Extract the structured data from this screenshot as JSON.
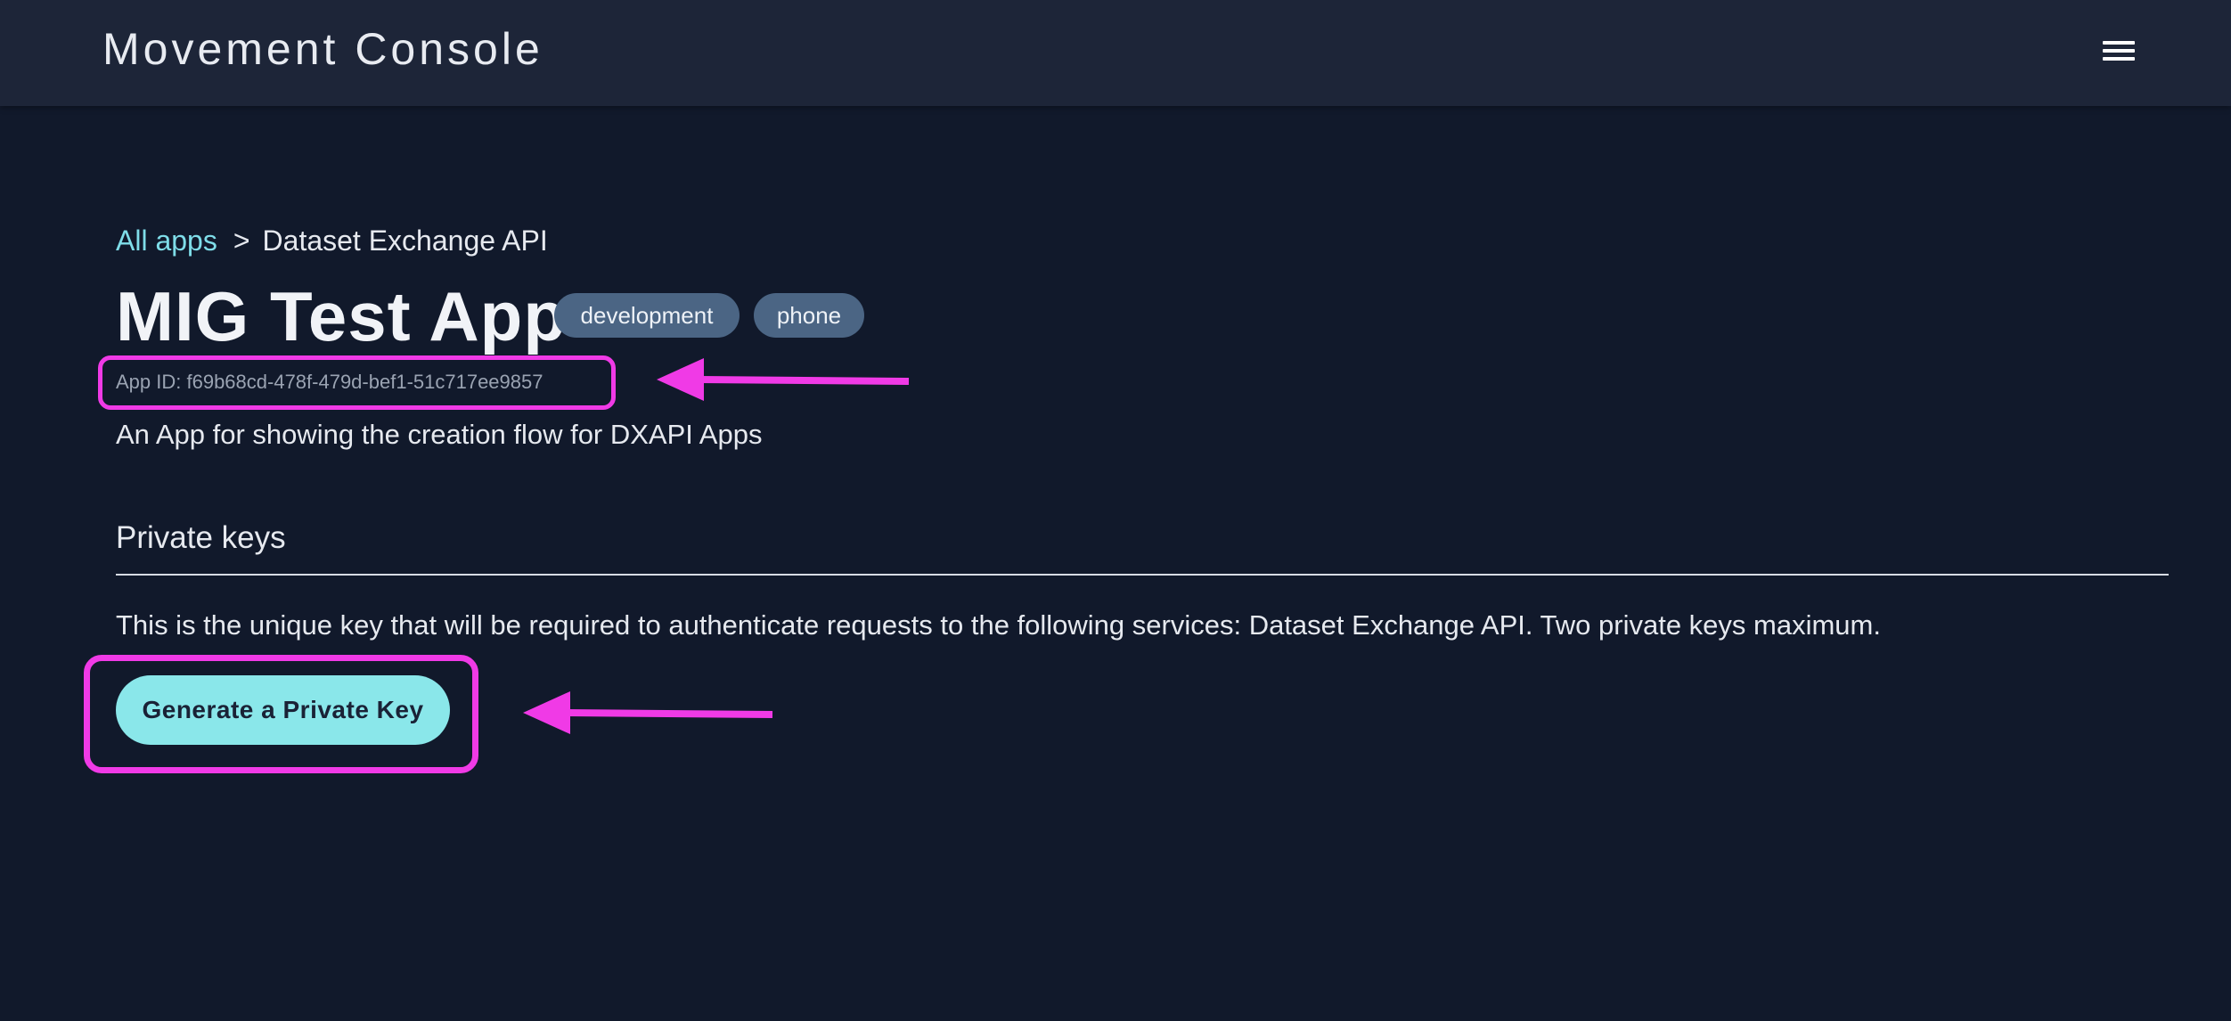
{
  "header": {
    "brand": "Movement Console",
    "menu_icon": "hamburger-menu-icon"
  },
  "breadcrumb": {
    "parent": "All apps",
    "separator": ">",
    "current": "Dataset Exchange API"
  },
  "app": {
    "title": "MIG Test App",
    "badges": [
      "development",
      "phone"
    ],
    "app_id": "App ID: f69b68cd-478f-479d-bef1-51c717ee9857",
    "description": "An App for showing the creation flow for DXAPI Apps"
  },
  "private_keys": {
    "heading": "Private keys",
    "description": "This is the unique key that will be required to authenticate requests to the following services: Dataset Exchange API. Two private keys maximum.",
    "button_label": "Generate a Private Key"
  },
  "colors": {
    "background": "#11192b",
    "topbar": "#1d2538",
    "link": "#7fdde9",
    "badge": "#4b6584",
    "button": "#8ae7ea",
    "annotation": "#f03ae6"
  }
}
